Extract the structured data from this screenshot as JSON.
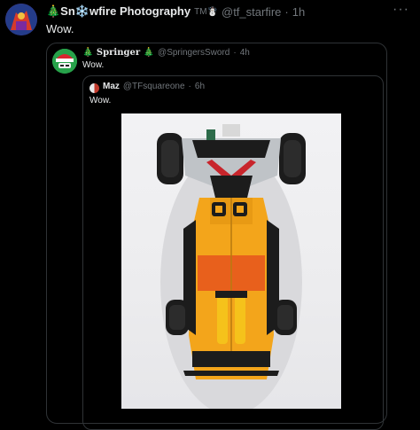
{
  "tweet": {
    "author_name": "🎄Sn❄️wfire Photography",
    "author_suffix": "TM☃️",
    "handle": "@tf_starfire",
    "separator": "·",
    "time": "1h",
    "text": "Wow.",
    "more_icon": "more-dots-icon"
  },
  "quote1": {
    "author_name": "🎄 Springer 🎄",
    "handle": "@SpringersSword",
    "separator": "·",
    "time": "4h",
    "text": "Wow."
  },
  "quote2": {
    "author_name": "Maz",
    "handle": "@TFsquareone",
    "separator": "·",
    "time": "6h",
    "text": "Wow."
  },
  "photo": {
    "subject": "yellow transformer toy race car, top-down view",
    "colors": {
      "body": "#f3a51b",
      "dark": "#1c1c1c",
      "silver": "#bfc3c7",
      "red": "#c8252c"
    }
  }
}
